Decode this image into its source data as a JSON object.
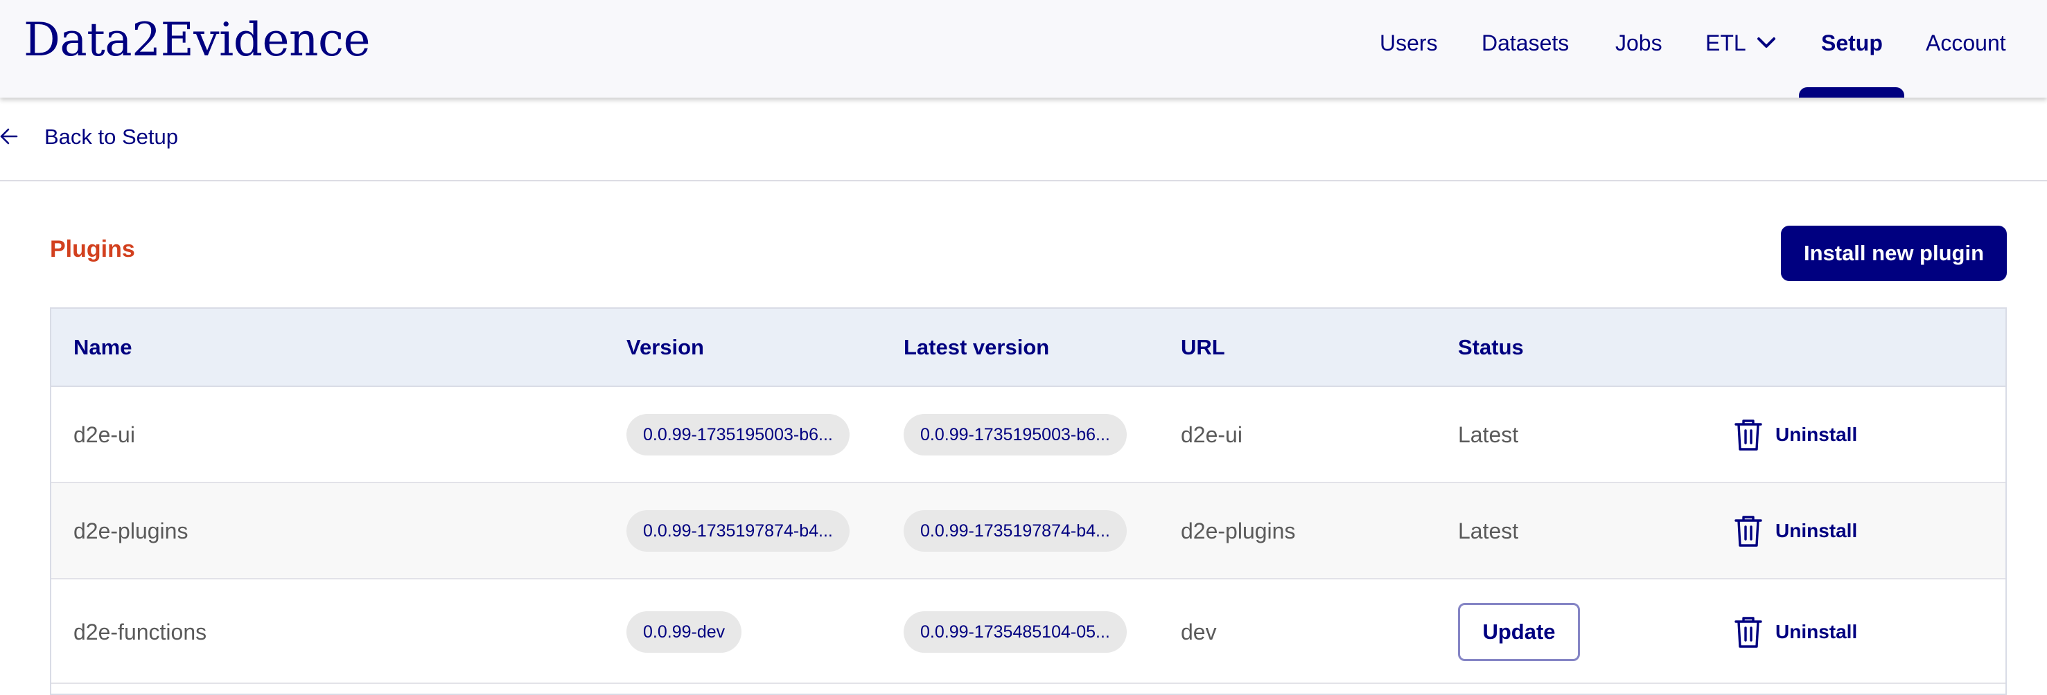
{
  "brand": {
    "name": "Data2Evidence"
  },
  "nav": {
    "users": "Users",
    "datasets": "Datasets",
    "jobs": "Jobs",
    "etl": "ETL",
    "setup": "Setup",
    "account": "Account",
    "active": "Setup"
  },
  "back": {
    "label": "Back to Setup",
    "icon": "arrow-left-icon"
  },
  "plugins": {
    "title": "Plugins",
    "install_label": "Install new plugin",
    "columns": {
      "name": "Name",
      "version": "Version",
      "latest": "Latest version",
      "url": "URL",
      "status": "Status"
    },
    "rows": [
      {
        "name": "d2e-ui",
        "version": "0.0.99-1735195003-b6...",
        "latest": "0.0.99-1735195003-b6...",
        "url": "d2e-ui",
        "status": "Latest",
        "action": "Uninstall"
      },
      {
        "name": "d2e-plugins",
        "version": "0.0.99-1735197874-b4...",
        "latest": "0.0.99-1735197874-b4...",
        "url": "d2e-plugins",
        "status": "Latest",
        "action": "Uninstall"
      },
      {
        "name": "d2e-functions",
        "version": "0.0.99-dev",
        "latest": "0.0.99-1735485104-05...",
        "url": "dev",
        "status": "Update",
        "action": "Uninstall"
      }
    ]
  },
  "colors": {
    "primary": "#000080",
    "accent": "#d2401e",
    "header_bg": "#eaeff7"
  },
  "icons": {
    "etl_toggle": "chevron-down-icon",
    "uninstall": "trash-icon"
  }
}
